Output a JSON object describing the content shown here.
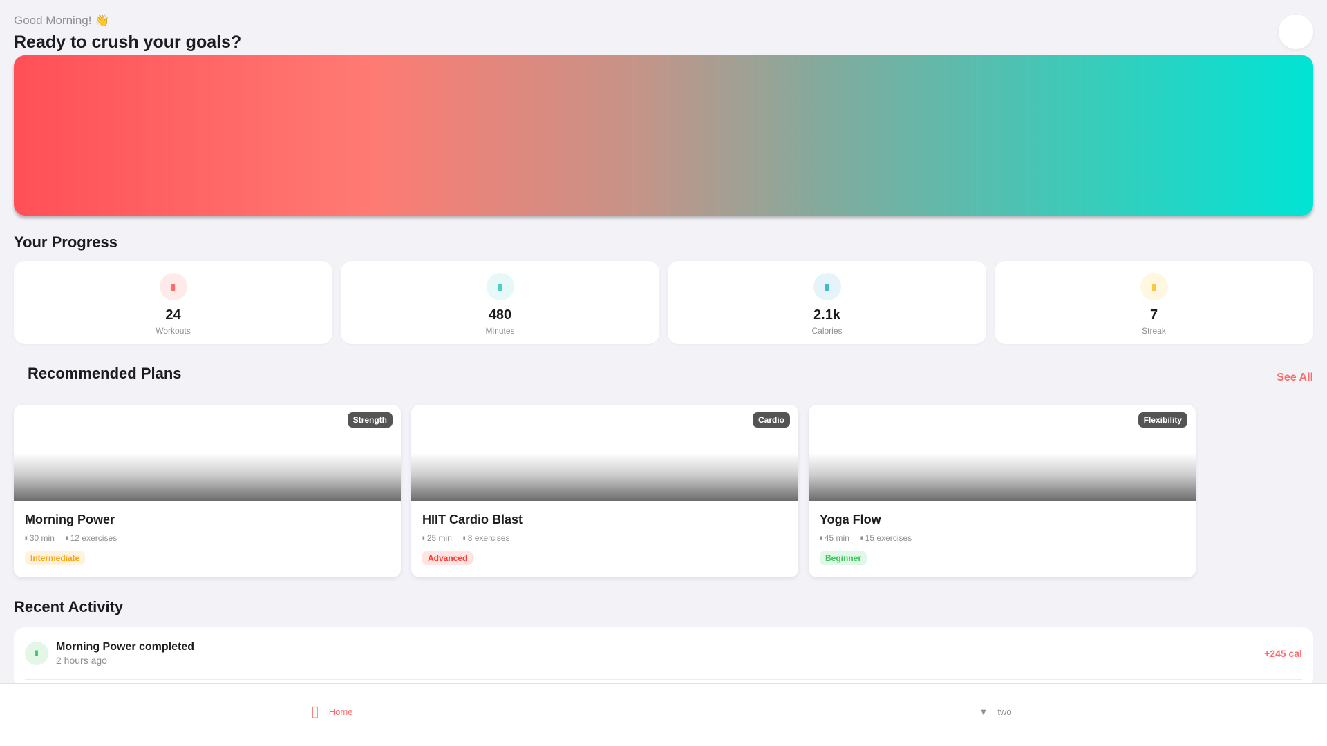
{
  "header": {
    "greeting": "Good Morning! 👋",
    "headline": "Ready to crush your goals?"
  },
  "progress": {
    "title": "Your Progress",
    "stats": [
      {
        "value": "24",
        "label": "Workouts",
        "icon": "dumbbell-icon",
        "color": "#ff6b6b",
        "bg": "#ffeaea"
      },
      {
        "value": "480",
        "label": "Minutes",
        "icon": "clock-icon",
        "color": "#4ecdc4",
        "bg": "#e6f8f7"
      },
      {
        "value": "2.1k",
        "label": "Calories",
        "icon": "flame-icon",
        "color": "#45b7d1",
        "bg": "#e5f4f9"
      },
      {
        "value": "7",
        "label": "Streak",
        "icon": "bolt-icon",
        "color": "#f7c948",
        "bg": "#fff7df"
      }
    ]
  },
  "plans": {
    "title": "Recommended Plans",
    "see_all": "See All",
    "items": [
      {
        "tag": "Strength",
        "title": "Morning Power",
        "duration": "30 min",
        "exercises": "12 exercises",
        "level": "Intermediate"
      },
      {
        "tag": "Cardio",
        "title": "HIIT Cardio Blast",
        "duration": "25 min",
        "exercises": "8 exercises",
        "level": "Advanced"
      },
      {
        "tag": "Flexibility",
        "title": "Yoga Flow",
        "duration": "45 min",
        "exercises": "15 exercises",
        "level": "Beginner"
      }
    ]
  },
  "activity": {
    "title": "Recent Activity",
    "items": [
      {
        "name": "Morning Power completed",
        "time": "2 hours ago",
        "calories": "+245 cal",
        "icon": "check-icon"
      }
    ]
  },
  "tabbar": {
    "home_label": "Home",
    "two_label": "two",
    "accent": "#ff6b6b"
  }
}
